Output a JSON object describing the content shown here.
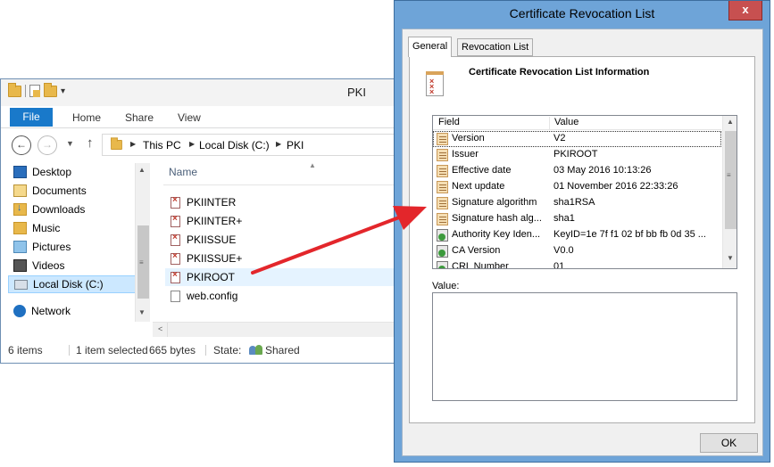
{
  "explorer": {
    "window_title": "PKI",
    "ribbon_tabs": [
      "File",
      "Home",
      "Share",
      "View"
    ],
    "breadcrumbs": [
      "This PC",
      "Local Disk (C:)",
      "PKI"
    ],
    "nav_items": [
      "Desktop",
      "Documents",
      "Downloads",
      "Music",
      "Pictures",
      "Videos",
      "Local Disk (C:)",
      "Network"
    ],
    "column_header": "Name",
    "files": [
      "PKIINTER",
      "PKIINTER+",
      "PKIISSUE",
      "PKIISSUE+",
      "PKIROOT",
      "web.config"
    ],
    "status": {
      "items": "6 items",
      "selection": "1 item selected",
      "size": "665 bytes",
      "state_label": "State:",
      "state_value": "Shared"
    }
  },
  "dialog": {
    "title": "Certificate Revocation List",
    "close_glyph": "x",
    "tabs": [
      "General",
      "Revocation List"
    ],
    "info_title": "Certificate Revocation List Information",
    "columns": [
      "Field",
      "Value"
    ],
    "rows": [
      {
        "field": "Version",
        "value": "V2",
        "icon": "doc"
      },
      {
        "field": "Issuer",
        "value": "PKIROOT",
        "icon": "doc"
      },
      {
        "field": "Effective date",
        "value": "03 May 2016 10:13:26",
        "icon": "doc"
      },
      {
        "field": "Next update",
        "value": "01 November 2016 22:33:26",
        "icon": "doc"
      },
      {
        "field": "Signature algorithm",
        "value": "sha1RSA",
        "icon": "doc"
      },
      {
        "field": "Signature hash alg...",
        "value": "sha1",
        "icon": "doc"
      },
      {
        "field": "Authority Key Iden...",
        "value": "KeyID=1e 7f f1 02 bf bb fb 0d 35 ...",
        "icon": "ext"
      },
      {
        "field": "CA Version",
        "value": "V0.0",
        "icon": "ext"
      },
      {
        "field": "CRL Number",
        "value": "01",
        "icon": "ext"
      }
    ],
    "value_label": "Value:",
    "ok_label": "OK"
  },
  "colors": {
    "arrow": "#e3262b",
    "file_tab": "#1979ca",
    "dialog_frame": "#6ea4d8",
    "selection": "#cce8ff"
  }
}
